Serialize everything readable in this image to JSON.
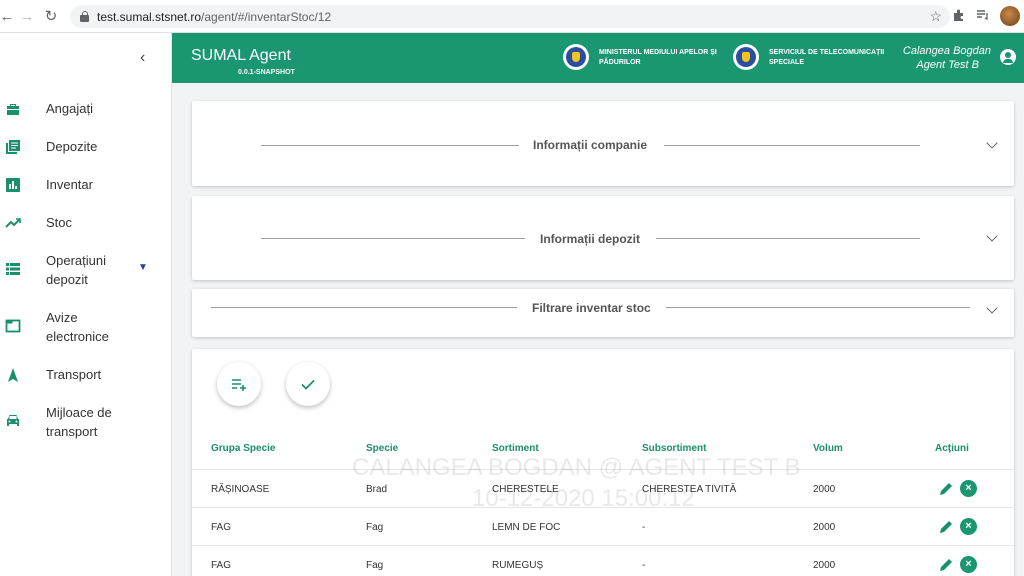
{
  "browser": {
    "url_host": "test.sumal.stsnet.ro",
    "url_path": "/agent/#/inventarStoc/12"
  },
  "sidebar": {
    "items": [
      {
        "label": "Angajați",
        "icon": "briefcase-icon"
      },
      {
        "label": "Depozite",
        "icon": "library-books-icon"
      },
      {
        "label": "Inventar",
        "icon": "bar-chart-icon"
      },
      {
        "label": "Stoc",
        "icon": "trending-up-icon"
      },
      {
        "label": "Operațiuni depozit",
        "icon": "list-icon",
        "expandable": true
      },
      {
        "label": "Avize electronice",
        "icon": "tab-icon"
      },
      {
        "label": "Transport",
        "icon": "navigation-icon"
      },
      {
        "label": "Mijloace de transport",
        "icon": "car-icon"
      }
    ]
  },
  "header": {
    "app_title": "SUMAL Agent",
    "version": "0.0.1-SNAPSHOT",
    "org1": "MINISTERUL MEDIULUI APELOR ȘI PĂDURILOR",
    "org2": "SERVICIUL DE TELECOMUNICAȚII SPECIALE",
    "user_name": "Calangea Bogdan",
    "user_role": "Agent Test B"
  },
  "panels": {
    "company": "Informații companie",
    "depot": "Informații depozit",
    "filter": "Filtrare inventar stoc"
  },
  "table": {
    "headers": {
      "group": "Grupa Specie",
      "species": "Specie",
      "sort": "Sortiment",
      "subsort": "Subsortiment",
      "volume": "Volum",
      "actions": "Acțiuni"
    },
    "rows": [
      {
        "group": "RĂȘINOASE",
        "species": "Brad",
        "sort": "CHERESTELE",
        "subsort": "CHERESTEA TIVITĂ",
        "volume": "2000"
      },
      {
        "group": "FAG",
        "species": "Fag",
        "sort": "LEMN DE FOC",
        "subsort": "-",
        "volume": "2000"
      },
      {
        "group": "FAG",
        "species": "Fag",
        "sort": "RUMEGUȘ",
        "subsort": "-",
        "volume": "2000"
      }
    ]
  },
  "watermark": {
    "line1": "CALANGEA BOGDAN @ AGENT TEST B",
    "line2": "10-12-2020 15:00:12"
  },
  "colors": {
    "primary": "#1a9771",
    "accent_icon": "#1a8f6c"
  }
}
